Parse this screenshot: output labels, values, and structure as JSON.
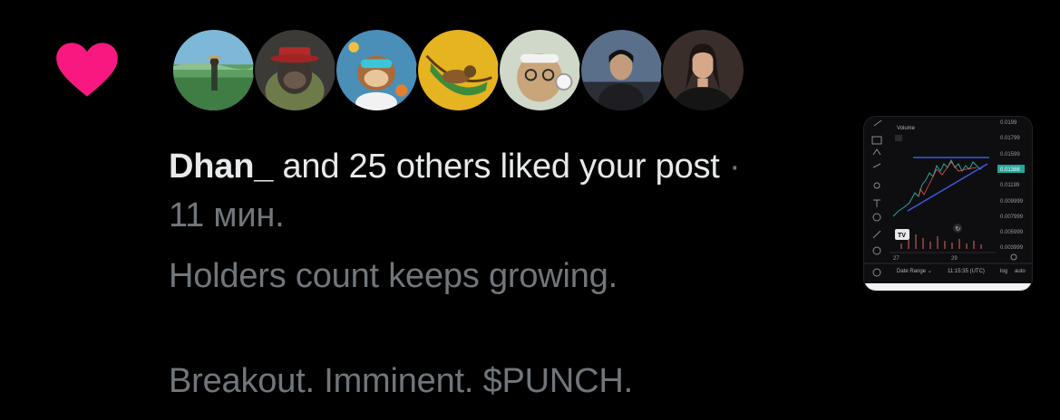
{
  "notification": {
    "icon": "heart-icon",
    "icon_color": "#f91880",
    "actor_name": "Dhan_",
    "action_text": " and 25 others liked your post",
    "separator": " · ",
    "time_ago": "11 мин.",
    "post_text_line1": "Holders count keeps growing.",
    "post_text_line2": "Breakout. Imminent. $PUNCH."
  },
  "avatars": [
    {
      "name": "avatar-landscape-figure",
      "bg": "#7db8d8"
    },
    {
      "name": "avatar-gorilla-red-hat",
      "bg": "#3b3a36"
    },
    {
      "name": "avatar-monkey-scientist",
      "bg": "#4a8fb8"
    },
    {
      "name": "avatar-hammock-cartoon",
      "bg": "#e6b321"
    },
    {
      "name": "avatar-cat-headphones",
      "bg": "#cfd8c9"
    },
    {
      "name": "avatar-person-dark",
      "bg": "#5a6f8a"
    },
    {
      "name": "avatar-woman-dark",
      "bg": "#3a2e2a"
    }
  ],
  "chart_thumbnail": {
    "top_label": "Volume",
    "price_ticks": [
      "0.0199",
      "0.01799",
      "0.01599",
      "0.01388",
      "0.01199",
      "0.009999",
      "0.007999",
      "0.005999",
      "0.003999"
    ],
    "highlight_price": "0.01388",
    "highlight_color": "#26a69a",
    "x_ticks": [
      "27",
      "29"
    ],
    "logo_text": "TV",
    "footer_left": "Date Range ⌄",
    "footer_time": "11:15:35 (UTC)",
    "footer_log": "log",
    "footer_auto": "auto"
  }
}
